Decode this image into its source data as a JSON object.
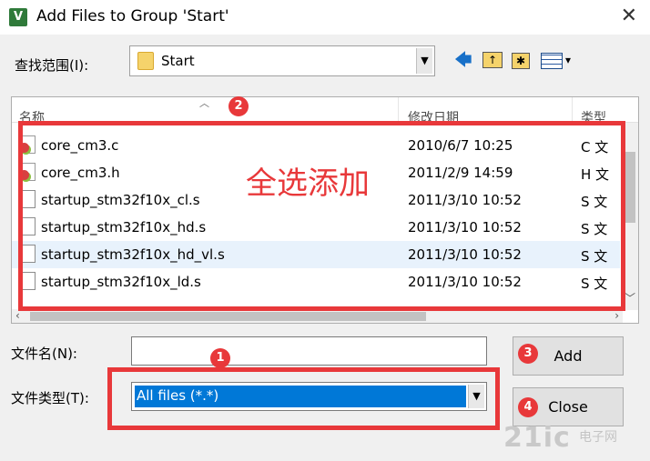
{
  "window": {
    "title": "Add Files to Group 'Start'",
    "app_icon": "V",
    "close_glyph": "✕"
  },
  "lookin": {
    "label": "查找范围(I):",
    "value": "Start"
  },
  "toolbar": {
    "back": "🡄",
    "up": "↑",
    "new_folder": "✱",
    "view_arrow": "▾"
  },
  "list": {
    "columns": [
      "名称",
      "修改日期",
      "类型"
    ],
    "rows": [
      {
        "name": "core_cm3.c",
        "date": "2010/6/7 10:25",
        "type": "C 文",
        "icon": "c-file-icon"
      },
      {
        "name": "core_cm3.h",
        "date": "2011/2/9 14:59",
        "type": "H 文",
        "icon": "h-file-icon"
      },
      {
        "name": "startup_stm32f10x_cl.s",
        "date": "2011/3/10 10:52",
        "type": "S 文",
        "icon": "file-icon"
      },
      {
        "name": "startup_stm32f10x_hd.s",
        "date": "2011/3/10 10:52",
        "type": "S 文",
        "icon": "file-icon"
      },
      {
        "name": "startup_stm32f10x_hd_vl.s",
        "date": "2011/3/10 10:52",
        "type": "S 文",
        "icon": "file-icon"
      },
      {
        "name": "startup_stm32f10x_ld.s",
        "date": "2011/3/10 10:52",
        "type": "S 文",
        "icon": "file-icon"
      }
    ]
  },
  "filename": {
    "label": "文件名(N):",
    "value": ""
  },
  "filetype": {
    "label": "文件类型(T):",
    "value": "All files (*.*)"
  },
  "buttons": {
    "add": "Add",
    "close": "Close"
  },
  "annotations": {
    "select_all_add": "全选添加",
    "badge1": "1",
    "badge2": "2",
    "badge3": "3",
    "badge4": "4"
  },
  "watermark": {
    "main": "21ic",
    "sub": "电子网"
  },
  "colors": {
    "annotation_red": "#e8383a",
    "selection_blue": "#0078d7",
    "row_highlight": "#e8f2fc"
  }
}
